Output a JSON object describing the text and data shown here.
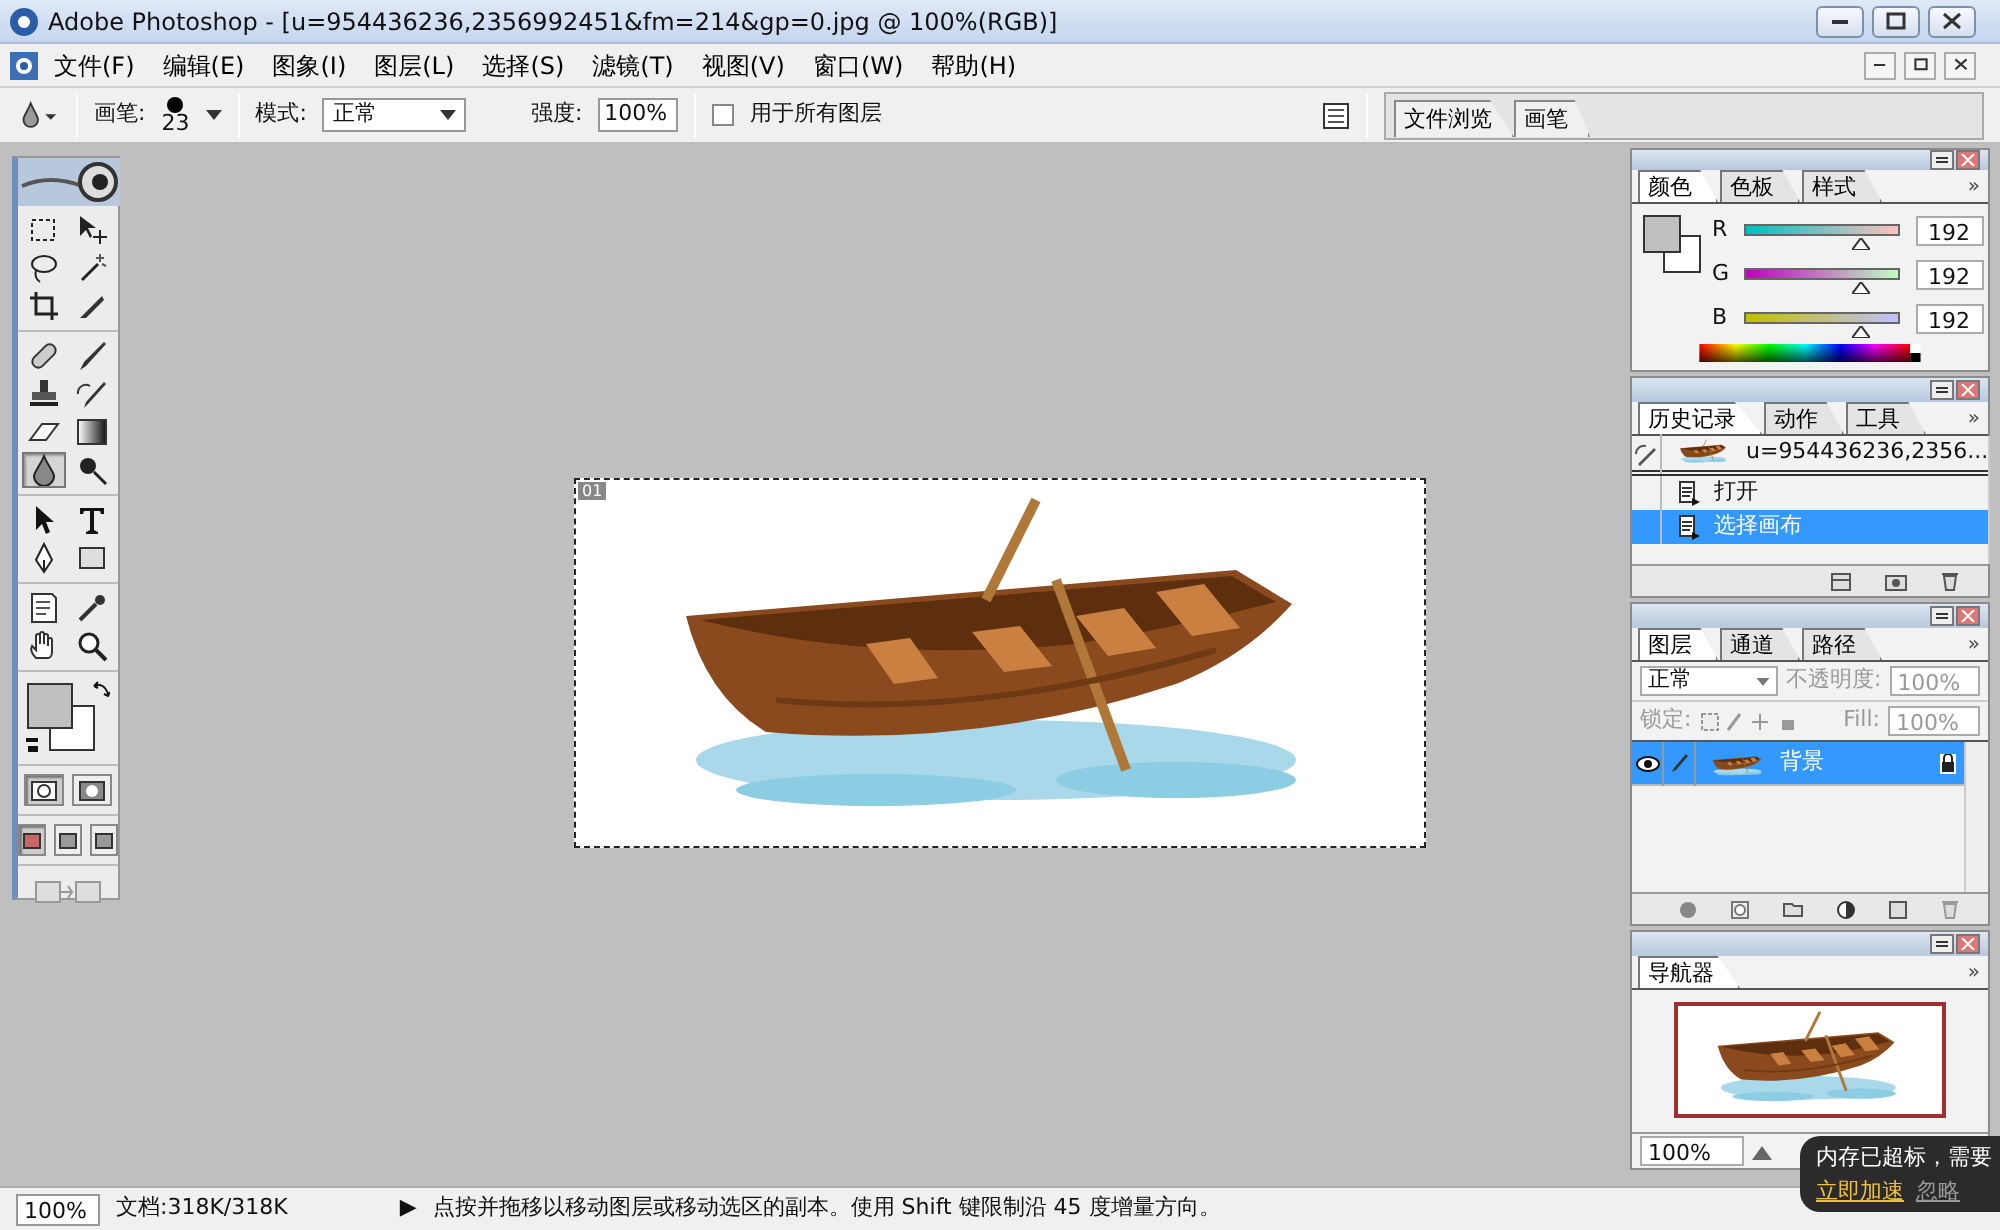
{
  "window": {
    "title": "Adobe Photoshop - [u=954436236,2356992451&fm=214&gp=0.jpg @ 100%(RGB)]"
  },
  "menu": [
    {
      "label": "文件(F)"
    },
    {
      "label": "编辑(E)"
    },
    {
      "label": "图象(I)"
    },
    {
      "label": "图层(L)"
    },
    {
      "label": "选择(S)"
    },
    {
      "label": "滤镜(T)"
    },
    {
      "label": "视图(V)"
    },
    {
      "label": "窗口(W)"
    },
    {
      "label": "帮助(H)"
    }
  ],
  "options_bar": {
    "brush_label": "画笔:",
    "brush_size": "23",
    "mode_label": "模式:",
    "mode_value": "正常",
    "strength_label": "强度:",
    "strength_value": "100%",
    "all_layers": {
      "label": "用于所有图层",
      "checked": false
    }
  },
  "well_tabs": [
    {
      "label": "文件浏览",
      "selected": false
    },
    {
      "label": "画笔",
      "selected": false
    }
  ],
  "toolbox": {
    "tool_groups": [
      {
        "tools": [
          {
            "kind": "marquee",
            "selected": false
          },
          {
            "kind": "move",
            "selected": false
          },
          {
            "kind": "lasso",
            "selected": false
          },
          {
            "kind": "wand",
            "selected": false
          },
          {
            "kind": "crop",
            "selected": false
          },
          {
            "kind": "slice",
            "selected": false
          }
        ]
      },
      {
        "tools": [
          {
            "kind": "healing",
            "selected": false
          },
          {
            "kind": "brush",
            "selected": false
          },
          {
            "kind": "stamp",
            "selected": false
          },
          {
            "kind": "history_brush",
            "selected": false
          },
          {
            "kind": "eraser",
            "selected": false
          },
          {
            "kind": "gradient",
            "selected": false
          },
          {
            "kind": "blur",
            "selected": true
          },
          {
            "kind": "dodge",
            "selected": false
          }
        ]
      },
      {
        "tools": [
          {
            "kind": "path_select",
            "selected": false
          },
          {
            "kind": "type",
            "selected": false
          },
          {
            "kind": "pen",
            "selected": false
          },
          {
            "kind": "shape",
            "selected": false
          }
        ]
      },
      {
        "tools": [
          {
            "kind": "notes",
            "selected": false
          },
          {
            "kind": "eyedropper",
            "selected": false
          },
          {
            "kind": "hand",
            "selected": false
          },
          {
            "kind": "zoom",
            "selected": false
          }
        ]
      }
    ],
    "swatches": [
      {
        "kind": "foreground",
        "color": "#c0c0c0"
      },
      {
        "kind": "background",
        "color": "#ffffff"
      }
    ],
    "mask_modes": [
      {
        "selected": true
      },
      {
        "selected": false
      }
    ],
    "screen_modes": [
      {
        "selected": true
      },
      {
        "selected": false
      },
      {
        "selected": false
      }
    ]
  },
  "document": {
    "badge": "01"
  },
  "color_panel": {
    "tabs": [
      {
        "label": "颜色",
        "selected": true
      },
      {
        "label": "色板",
        "selected": false
      },
      {
        "label": "样式",
        "selected": false
      }
    ],
    "menu_arrow": "»",
    "swatches": [
      {
        "kind": "foreground",
        "color": "#c0c0c0"
      },
      {
        "kind": "background",
        "color": "#ffffff"
      }
    ],
    "channels": [
      {
        "label": "R",
        "level": 0.753,
        "value": "192"
      },
      {
        "label": "G",
        "level": 0.753,
        "value": "192"
      },
      {
        "label": "B",
        "level": 0.753,
        "value": "192"
      }
    ]
  },
  "history_panel": {
    "tabs": [
      {
        "label": "历史记录",
        "selected": true
      },
      {
        "label": "动作",
        "selected": false
      },
      {
        "label": "工具",
        "selected": false
      }
    ],
    "menu_arrow": "»",
    "snapshot": {
      "label": "u=954436236,2356..."
    },
    "items": [
      {
        "label": "打开",
        "selected": false
      },
      {
        "label": "选择画布",
        "selected": true
      }
    ]
  },
  "layers_panel": {
    "tabs": [
      {
        "label": "图层",
        "selected": true
      },
      {
        "label": "通道",
        "selected": false
      },
      {
        "label": "路径",
        "selected": false
      }
    ],
    "menu_arrow": "»",
    "blend_mode": "正常",
    "opacity_label": "不透明度:",
    "opacity_value": "100%",
    "lock_label": "锁定:",
    "fill_label": "Fill:",
    "fill_value": "100%",
    "controls_disabled": true,
    "layers": [
      {
        "name": "背景",
        "selected": true,
        "visible": true,
        "locked": true
      }
    ]
  },
  "navigator_panel": {
    "tabs": [
      {
        "label": "导航器",
        "selected": true
      }
    ],
    "menu_arrow": "»",
    "zoom_value": "100%"
  },
  "status_bar": {
    "zoom": "100%",
    "doc_info": "文档:318K/318K",
    "arrow": "▶",
    "message": "点按并拖移以移动图层或移动选区的副本。使用 Shift 键限制沿 45 度增量方向。"
  },
  "notification": {
    "message": "内存已超标，需要",
    "action": "立即加速",
    "dismiss": "忽略"
  }
}
